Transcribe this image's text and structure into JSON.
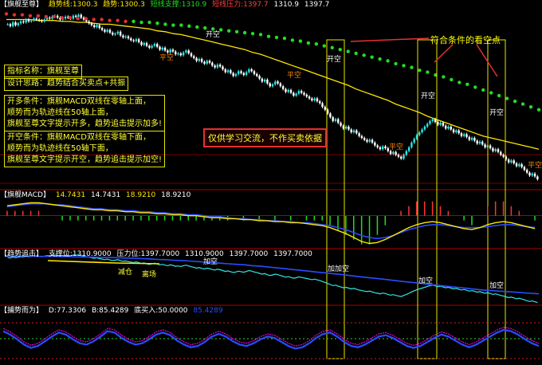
{
  "colors": {
    "bg": "#000000",
    "up": "#2ee6e6",
    "down": "#ffffff",
    "stop_green": "#22dd22",
    "stop_red": "#e03030",
    "ma_yellow": "#ffe600",
    "macd_dif": "#ffe600",
    "macd_dea": "#2b4bff",
    "rebound": "#e600e6"
  },
  "headers": {
    "main": {
      "title": "【旗舰至尊】",
      "items": [
        "趋势线:1300.3",
        "趋势:1300.3",
        "短线支撑:1310.9",
        "短线压力:1397.7",
        "1310.9",
        "1397.7"
      ]
    },
    "macd": {
      "title": "【旗舰MACD】",
      "items": [
        "14.7431",
        "14.7431",
        "18.9210",
        "18.9210"
      ]
    },
    "trend": {
      "title": "【趋势追击】",
      "items": [
        "支撑位:1310.9000",
        "压力位:1397.7000",
        "1310.9000",
        "1397.7000",
        "1397.7000"
      ]
    },
    "rebound": {
      "title": "【捕势而为】",
      "items": [
        "D:77.3306",
        "B:85.4289",
        "底买入:50.0000"
      ],
      "extra": "85.4289"
    }
  },
  "info_boxes": [
    {
      "lines": [
        "指标名称：旗舰至尊"
      ]
    },
    {
      "lines": [
        "设计思路：趋势结合买卖点+共振"
      ]
    },
    {
      "lines": [
        "开多条件：旗舰MACD双线在零轴上面，",
        "顺势而为轨迹线在50轴上面，",
        "旗舰至尊文字提示开多，趋势追击提示加多!"
      ]
    },
    {
      "lines": [
        "开空条件：旗舰MACD双线在零轴下面，",
        "顺势而为轨迹线在50轴下面，",
        "旗舰至尊文字提示开空，趋势追击提示加空!"
      ]
    }
  ],
  "disclaimer": "仅供学习交流，不作买卖依据",
  "callout": "符合条件的看空点",
  "signals_main": [
    {
      "text": "平空",
      "color": "#ff8800"
    },
    {
      "text": "开空",
      "color": "#ffffff"
    },
    {
      "text": "平空",
      "color": "#ff8800"
    },
    {
      "text": "开空",
      "color": "#ffffff"
    },
    {
      "text": "开空",
      "color": "#ffffff"
    },
    {
      "text": "平空",
      "color": "#ff8800"
    },
    {
      "text": "开空",
      "color": "#ffffff"
    },
    {
      "text": "平空",
      "color": "#ff8800"
    },
    {
      "text": "开空",
      "color": "#ffffff"
    },
    {
      "text": "平空",
      "color": "#ff8800"
    }
  ],
  "signals_trend": [
    {
      "text": "减仓",
      "color": "#ffff33"
    },
    {
      "text": "离场",
      "color": "#ffff33"
    },
    {
      "text": "加空",
      "color": "#ffffff"
    },
    {
      "text": "加加空",
      "color": "#ffffff"
    },
    {
      "text": "加空",
      "color": "#ffffff"
    },
    {
      "text": "加空",
      "color": "#ffffff"
    }
  ],
  "chart_data": {
    "type": "candlestick",
    "candles_close": [
      1391,
      1389,
      1393,
      1390,
      1392,
      1394,
      1393,
      1396,
      1394,
      1395,
      1397,
      1396,
      1395,
      1394,
      1396,
      1398,
      1397,
      1399,
      1400,
      1398,
      1396,
      1397,
      1399,
      1398,
      1397,
      1400,
      1399,
      1401,
      1398,
      1396,
      1394,
      1392,
      1390,
      1388,
      1390,
      1387,
      1385,
      1383,
      1385,
      1382,
      1380,
      1381,
      1383,
      1379,
      1377,
      1378,
      1376,
      1374,
      1373,
      1375,
      1372,
      1369,
      1371,
      1368,
      1366,
      1368,
      1370,
      1367,
      1364,
      1366,
      1363,
      1361,
      1364,
      1362,
      1359,
      1360,
      1358,
      1361,
      1363,
      1360,
      1357,
      1355,
      1352,
      1354,
      1351,
      1349,
      1352,
      1350,
      1347,
      1345,
      1348,
      1346,
      1343,
      1340,
      1342,
      1339,
      1336,
      1338,
      1341,
      1339,
      1337,
      1340,
      1343,
      1341,
      1338,
      1336,
      1333,
      1330,
      1332,
      1328,
      1325,
      1327,
      1330,
      1328,
      1325,
      1322,
      1319,
      1321,
      1318,
      1315,
      1317,
      1320,
      1318,
      1316,
      1314,
      1312,
      1310,
      1312,
      1309,
      1307,
      1303,
      1300,
      1296,
      1292,
      1288,
      1290,
      1286,
      1283,
      1280,
      1282,
      1279,
      1276,
      1278,
      1275,
      1272,
      1270,
      1268,
      1266,
      1268,
      1265,
      1262,
      1260,
      1258,
      1261,
      1259,
      1256,
      1253,
      1255,
      1252,
      1250,
      1248,
      1252,
      1256,
      1260,
      1265,
      1269,
      1273,
      1276,
      1279,
      1282,
      1285,
      1288,
      1290,
      1287,
      1284,
      1286,
      1283,
      1280,
      1282,
      1279,
      1276,
      1278,
      1275,
      1272,
      1274,
      1271,
      1268,
      1270,
      1267,
      1264,
      1266,
      1263,
      1260,
      1262,
      1259,
      1256,
      1258,
      1255,
      1252,
      1250,
      1247,
      1244,
      1246,
      1243,
      1240,
      1242,
      1239,
      1236,
      1233,
      1230,
      1232,
      1229,
      1226
    ],
    "stop_line": [
      1402,
      1401,
      1401,
      1400,
      1400,
      1399,
      1399,
      1398,
      1398,
      1397,
      1397,
      1396,
      1396,
      1395,
      1395,
      1394,
      1394,
      1393,
      1393,
      1392,
      1391,
      1390,
      1390,
      1389,
      1388,
      1387,
      1386,
      1385,
      1384,
      1383,
      1382,
      1381,
      1380,
      1378,
      1377,
      1376,
      1374,
      1373,
      1371,
      1370,
      1368,
      1366,
      1364,
      1362,
      1360,
      1358,
      1356,
      1354,
      1352,
      1349,
      1347,
      1345,
      1342,
      1340,
      1337,
      1335,
      1332,
      1329,
      1327,
      1324,
      1321,
      1318,
      1315,
      1312,
      1309,
      1306,
      1303,
      1300
    ],
    "ma_line": [
      1396,
      1396,
      1396,
      1396,
      1395,
      1395,
      1395,
      1394,
      1394,
      1393,
      1393,
      1392,
      1391,
      1391,
      1390,
      1389,
      1388,
      1387,
      1386,
      1384,
      1383,
      1381,
      1380,
      1378,
      1376,
      1374,
      1372,
      1370,
      1368,
      1366,
      1364,
      1361,
      1359,
      1356,
      1353,
      1350,
      1347,
      1344,
      1341,
      1338,
      1335,
      1332,
      1329,
      1326,
      1322,
      1319,
      1316,
      1313,
      1310,
      1306,
      1303,
      1300,
      1297,
      1293,
      1290,
      1287,
      1284,
      1281,
      1278,
      1275,
      1272,
      1270,
      1268,
      1266,
      1264,
      1262,
      1260,
      1258
    ],
    "macd_dif": [
      10,
      11,
      12,
      13,
      13,
      12,
      11,
      10,
      9,
      8,
      7,
      6,
      6,
      5,
      5,
      4,
      4,
      3,
      3,
      2,
      2,
      1,
      1,
      0,
      0,
      -1,
      -2,
      -2,
      -3,
      -3,
      -4,
      -4,
      -5,
      -5,
      -6,
      -6,
      -7,
      -7,
      -8,
      -9,
      -10,
      -12,
      -15,
      -18,
      -22,
      -26,
      -28,
      -27,
      -24,
      -20,
      -16,
      -12,
      -9,
      -7,
      -6,
      -7,
      -9,
      -11,
      -13,
      -14,
      -12,
      -9,
      -7,
      -6,
      -7,
      -9,
      -11,
      -13
    ],
    "macd_dea": [
      9,
      10,
      11,
      12,
      12,
      12,
      11,
      11,
      10,
      9,
      8,
      7,
      7,
      6,
      6,
      5,
      5,
      4,
      4,
      3,
      3,
      2,
      2,
      1,
      1,
      0,
      -1,
      -1,
      -2,
      -3,
      -3,
      -4,
      -4,
      -5,
      -5,
      -6,
      -6,
      -7,
      -7,
      -8,
      -9,
      -10,
      -12,
      -14,
      -17,
      -20,
      -22,
      -23,
      -22,
      -20,
      -17,
      -14,
      -12,
      -10,
      -9,
      -9,
      -10,
      -11,
      -12,
      -12,
      -12,
      -11,
      -10,
      -9,
      -9,
      -10,
      -11,
      -12
    ],
    "rebound_d": [
      60,
      55,
      48,
      40,
      35,
      38,
      45,
      52,
      58,
      55,
      48,
      42,
      40,
      45,
      52,
      60,
      58,
      50,
      44,
      40,
      42,
      48,
      55,
      58,
      54,
      46,
      40,
      36,
      38,
      44,
      52,
      56,
      52,
      45,
      40,
      38,
      42,
      48,
      52,
      50,
      44,
      38,
      34,
      36,
      42,
      50,
      56,
      58,
      52,
      44,
      38,
      36,
      40,
      46,
      52,
      54,
      50,
      44,
      38,
      35,
      38,
      44,
      50,
      55,
      52,
      46,
      40,
      36,
      40,
      46,
      52,
      58,
      62,
      60,
      55,
      48,
      42,
      38
    ],
    "levels": {
      "support": 1310.9,
      "resistance": 1397.7,
      "trend": 1300.3,
      "rebound_base": 50
    }
  }
}
